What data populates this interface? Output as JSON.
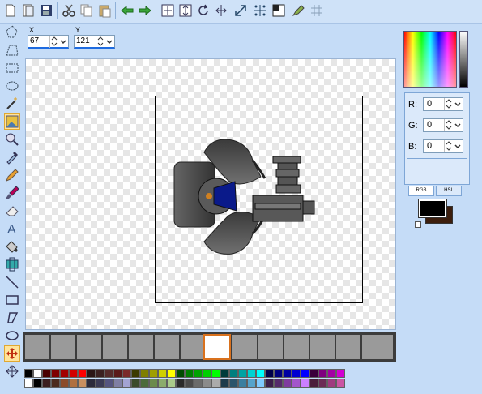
{
  "toolbar": {
    "buttons": [
      "new-file",
      "open-file",
      "save",
      "cut",
      "copy",
      "paste",
      "undo",
      "redo",
      "resize-canvas",
      "resize-sprite",
      "rotate",
      "flip",
      "scale",
      "center",
      "mask",
      "tint",
      "grid"
    ]
  },
  "coords": {
    "x_label": "X",
    "x_value": "67",
    "y_label": "Y",
    "y_value": "121"
  },
  "tools": [
    "lasso-select",
    "poly-select",
    "rect-select",
    "ellipse-select",
    "magic-wand",
    "image-select",
    "zoom",
    "eyedropper",
    "pencil",
    "brush",
    "eraser",
    "text",
    "fill",
    "replace",
    "line",
    "rectangle",
    "polygon",
    "ellipse",
    "move",
    "pan"
  ],
  "timeline": {
    "frame_count": 14,
    "selected_index": 7
  },
  "color_panel": {
    "r_label": "R:",
    "r_value": "0",
    "g_label": "G:",
    "g_value": "0",
    "b_label": "B:",
    "b_value": "0",
    "tab_rgb": "RGB",
    "tab_hsl": "HSL",
    "primary_color": "#000000",
    "secondary_color": "#3c1e0e"
  },
  "palette": {
    "row1": [
      "#000000",
      "#ffffff",
      "#4b0000",
      "#7f0000",
      "#a30000",
      "#d20000",
      "#ff0000",
      "#2b1515",
      "#3b2020",
      "#552b2b",
      "#5a1a1a",
      "#7b2b2b",
      "#3b3b00",
      "#7f7f00",
      "#9f9f00",
      "#cfcf00",
      "#ffff00",
      "#004b00",
      "#007f00",
      "#00a300",
      "#00cf00",
      "#00ff00",
      "#003b3b",
      "#007f7f",
      "#00a3a3",
      "#00d2d2",
      "#00ffff",
      "#00004b",
      "#00007f",
      "#0000a3",
      "#0000d2",
      "#0000ff",
      "#3b003b",
      "#7f007f",
      "#a300a3",
      "#d200d2"
    ],
    "row2": [
      "#ffffff",
      "#000000",
      "#3b1e1e",
      "#4b2b1e",
      "#8b4b2b",
      "#b07040",
      "#c89060",
      "#2b2b3b",
      "#3b3b55",
      "#55557f",
      "#7f7fa3",
      "#a3a3d2",
      "#3b4b2b",
      "#4b6b3b",
      "#6b8b4b",
      "#8bab6b",
      "#abcb8b",
      "#2b2b2b",
      "#4b4b4b",
      "#6b6b6b",
      "#8b8b8b",
      "#ababab",
      "#1e3b4b",
      "#2b556b",
      "#3b7f9f",
      "#55a3cb",
      "#7fcbff",
      "#3b1e4b",
      "#552b6b",
      "#7f3b9f",
      "#a355cb",
      "#cb7fff",
      "#4b1e3b",
      "#6b2b55",
      "#9f3b7f",
      "#cb55a3"
    ]
  }
}
